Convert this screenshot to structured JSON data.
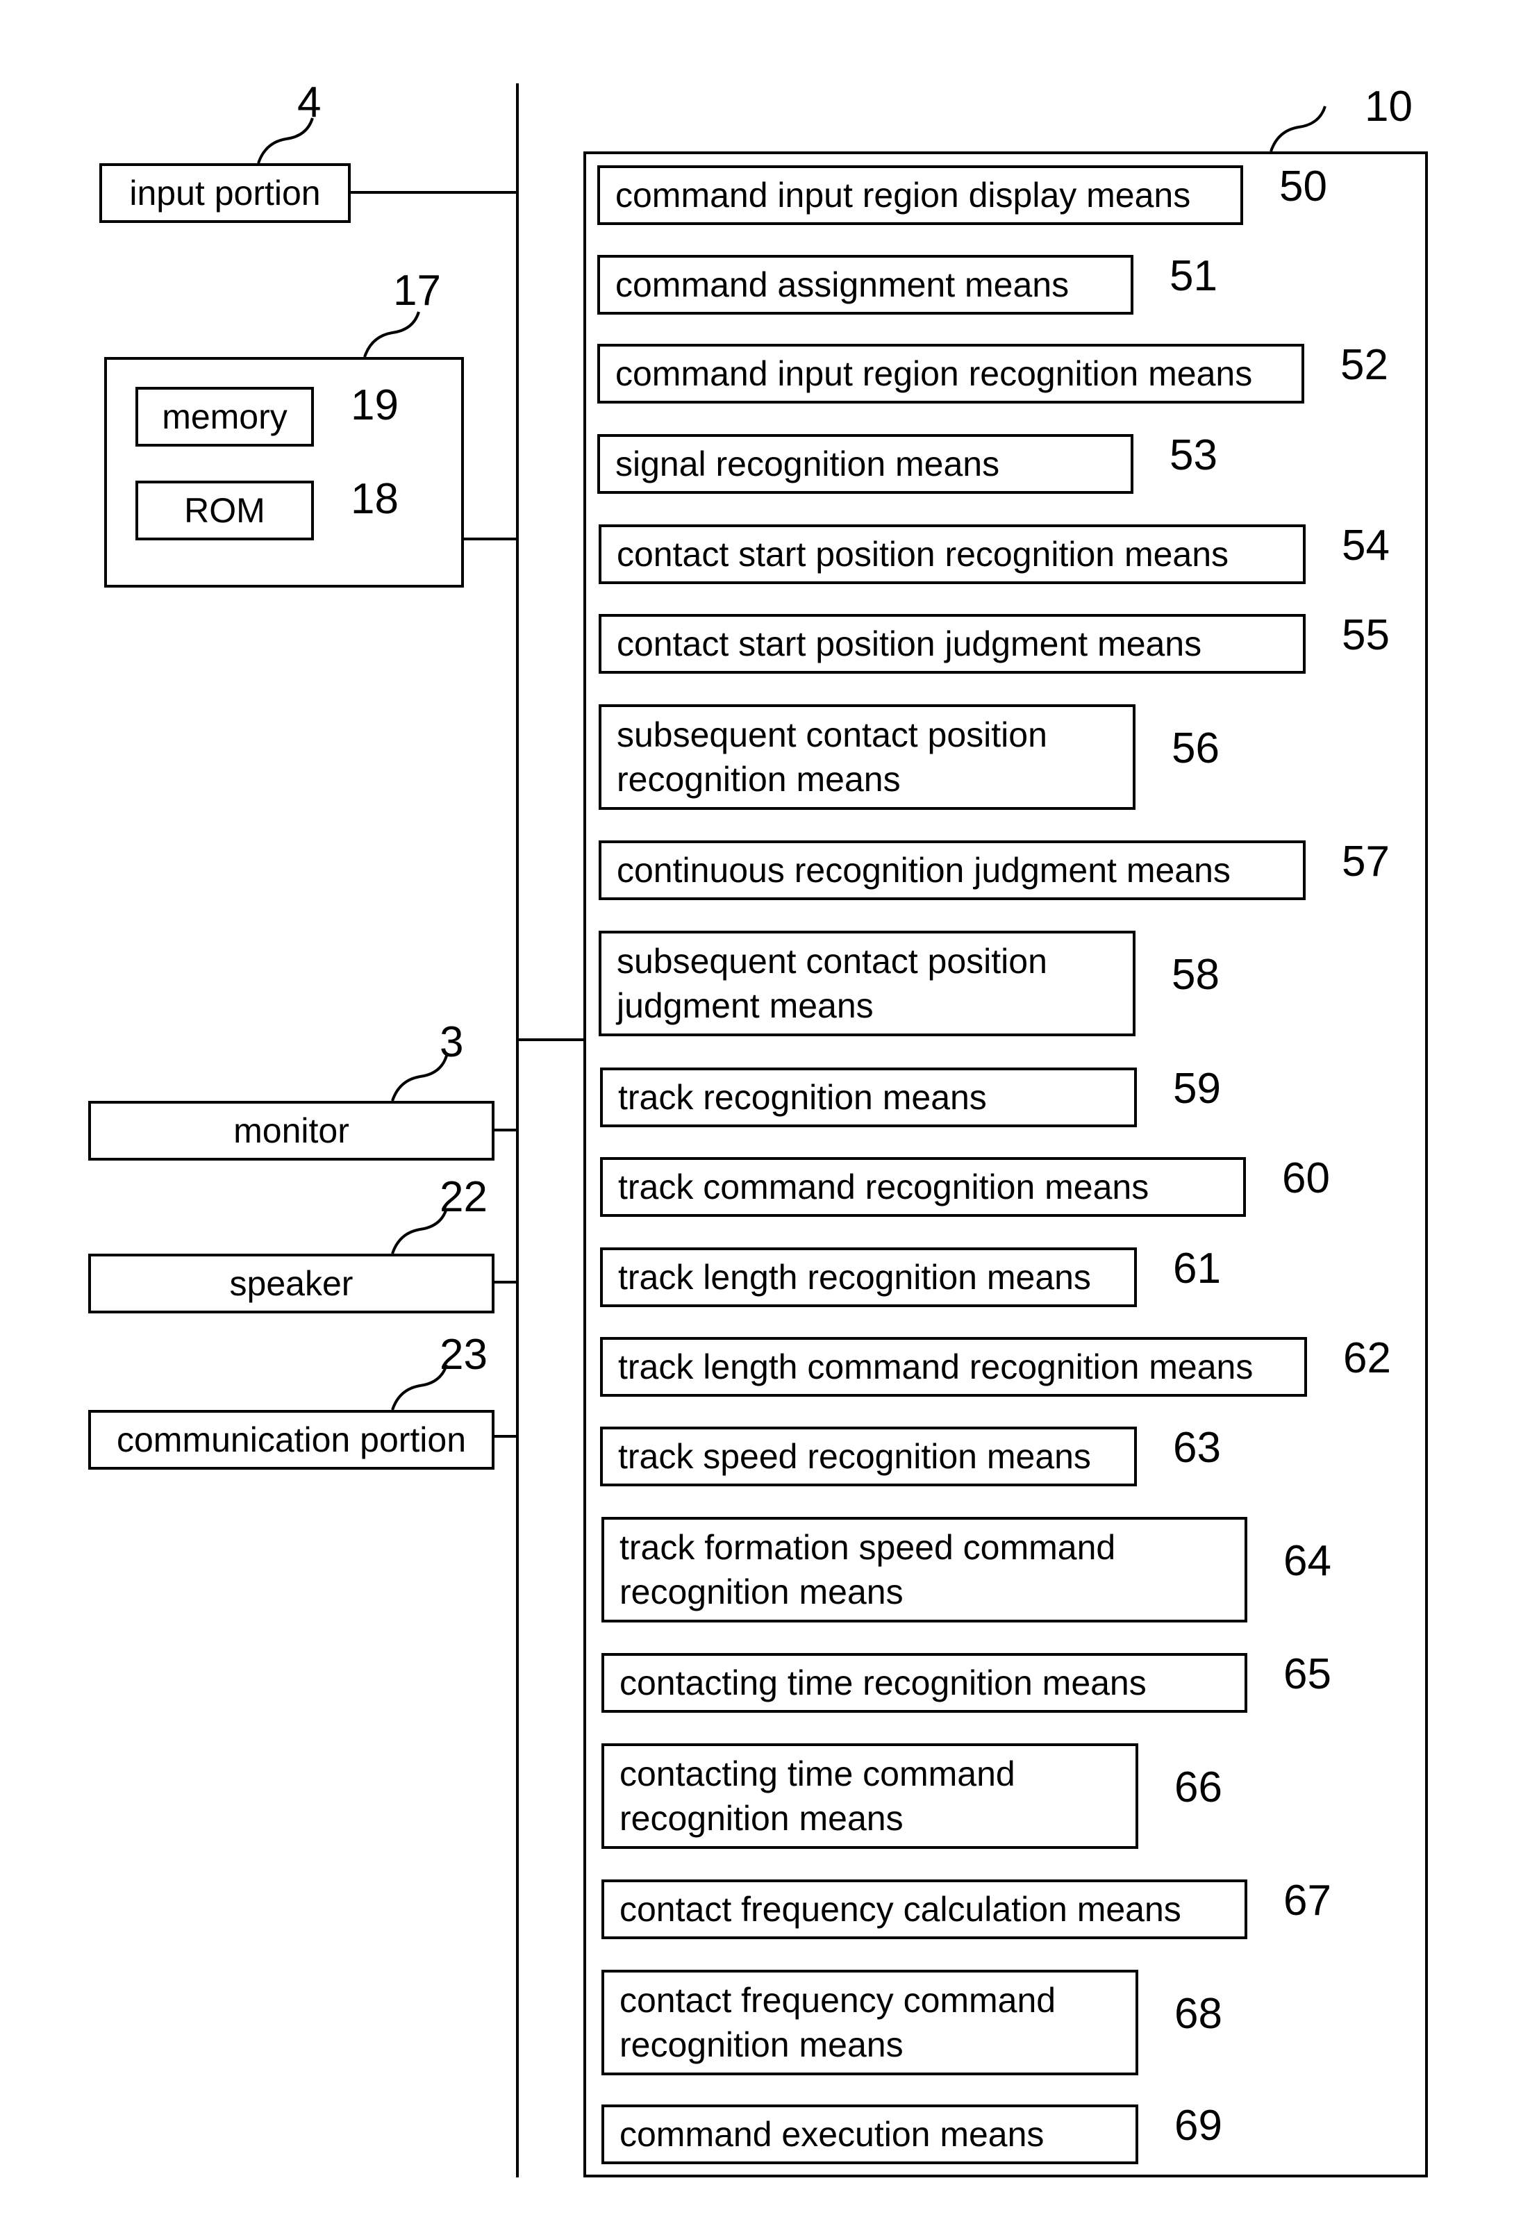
{
  "left_blocks": [
    {
      "label": "input portion",
      "ref": "4"
    },
    {
      "label": "",
      "ref": "17"
    },
    {
      "label": "memory",
      "ref": "19"
    },
    {
      "label": "ROM",
      "ref": "18"
    },
    {
      "label": "monitor",
      "ref": "3"
    },
    {
      "label": "speaker",
      "ref": "22"
    },
    {
      "label": "communication portion",
      "ref": "23"
    }
  ],
  "control_unit": {
    "ref": "10"
  },
  "means": [
    {
      "label": "command input region display means",
      "ref": "50"
    },
    {
      "label": "command assignment means",
      "ref": "51"
    },
    {
      "label": "command input region recognition means",
      "ref": "52"
    },
    {
      "label": "signal recognition means",
      "ref": "53"
    },
    {
      "label": "contact start position recognition means",
      "ref": "54"
    },
    {
      "label": "contact start position judgment means",
      "ref": "55"
    },
    {
      "label": "subsequent contact position recognition means",
      "ref": "56"
    },
    {
      "label": "continuous recognition judgment means",
      "ref": "57"
    },
    {
      "label": "subsequent contact position judgment means",
      "ref": "58"
    },
    {
      "label": "track recognition means",
      "ref": "59"
    },
    {
      "label": "track command recognition means",
      "ref": "60"
    },
    {
      "label": "track length recognition means",
      "ref": "61"
    },
    {
      "label": "track length command recognition means",
      "ref": "62"
    },
    {
      "label": "track speed recognition means",
      "ref": "63"
    },
    {
      "label": "track formation speed command recognition means",
      "ref": "64"
    },
    {
      "label": "contacting time recognition means",
      "ref": "65"
    },
    {
      "label": "contacting time command recognition means",
      "ref": "66"
    },
    {
      "label": "contact frequency calculation means",
      "ref": "67"
    },
    {
      "label": "contact frequency command recognition means",
      "ref": "68"
    },
    {
      "label": "command execution means",
      "ref": "69"
    }
  ]
}
